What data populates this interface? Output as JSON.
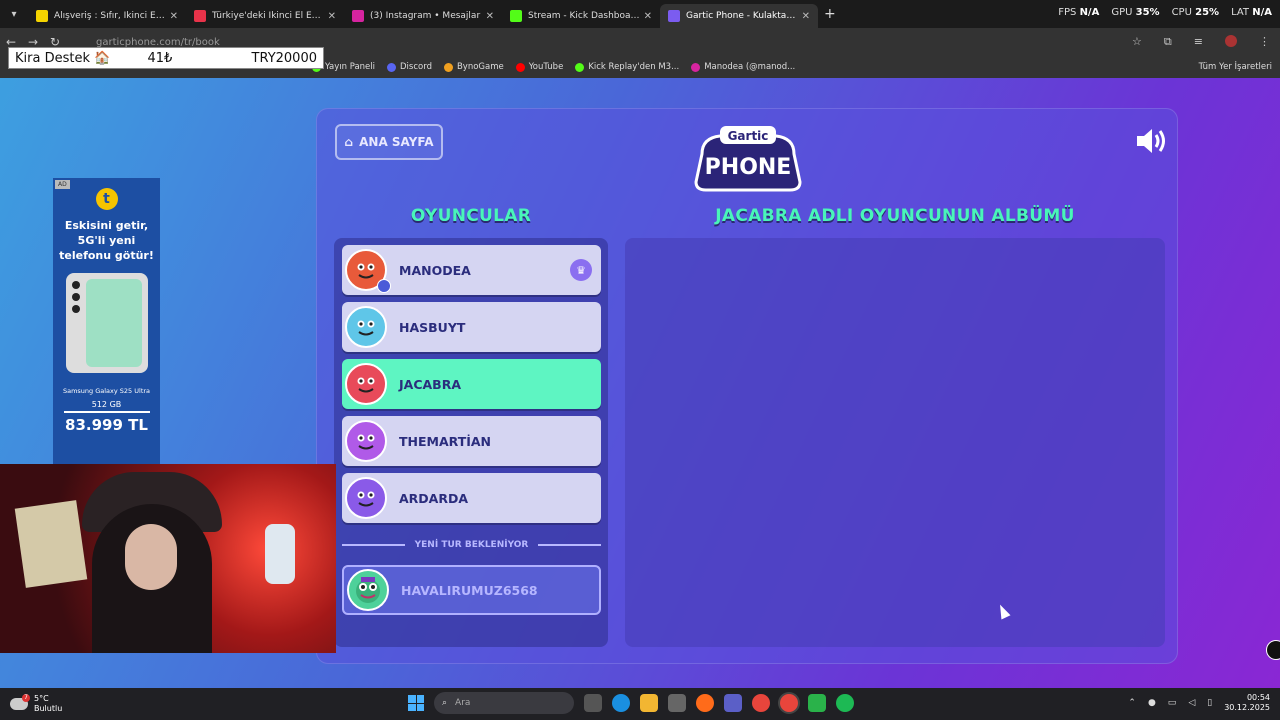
{
  "browser": {
    "tabs": [
      {
        "title": "Alışveriş : Sıfır, İkinci El Ürünler",
        "favicon_color": "#f5d400",
        "active": false
      },
      {
        "title": "Türkiye'deki İkinci El Eşyaları Al",
        "favicon_color": "#e8334a",
        "active": false
      },
      {
        "title": "(3) Instagram • Mesajlar",
        "favicon_color": "#d6249f",
        "active": false
      },
      {
        "title": "Stream - Kick Dashboard",
        "favicon_color": "#53fc18",
        "active": false
      },
      {
        "title": "Gartic Phone - Kulaktan Kulağa",
        "favicon_color": "#7b5cf0",
        "active": true
      }
    ],
    "new_tab": "+",
    "sysmon": {
      "fps_label": "FPS",
      "fps_value": "N/A",
      "gpu_label": "GPU",
      "gpu_value": "35",
      "cpu_label": "CPU",
      "cpu_value": "25",
      "lat_label": "LAT",
      "lat_value": "N/A"
    },
    "url": "garticphone.com/tr/book",
    "bookmarks": [
      {
        "label": "Yayın Paneli",
        "color": "#53fc18"
      },
      {
        "label": "Discord",
        "color": "#5865f2"
      },
      {
        "label": "BynoGame",
        "color": "#f0a020"
      },
      {
        "label": "YouTube",
        "color": "#ff0000"
      },
      {
        "label": "Kick Replay'den M3...",
        "color": "#53fc18"
      },
      {
        "label": "Manodea (@manod...",
        "color": "#d6249f"
      }
    ],
    "bookmarks_folder": "Tüm Yer İşaretleri"
  },
  "overlay": {
    "kira_label": "Kira Destek 🏠",
    "kira_amount": "41₺",
    "kira_goal": "TRY20000"
  },
  "ad": {
    "tag": "AD",
    "brand_letter": "t",
    "headline": "Eskisini getir, 5G'li yeni telefonu götür!",
    "model": "Samsung Galaxy S25 Ultra",
    "storage": "512 GB",
    "price": "83.999 TL"
  },
  "game": {
    "home_button": "ANA SAYFA",
    "logo_top": "Gartic",
    "logo_main": "PHONE",
    "players_title": "OYUNCULAR",
    "album_title": "JACABRA ADLI OYUNCUNUN ALBÜMÜ",
    "players": [
      {
        "name": "MANODEA",
        "selected": false,
        "host": true,
        "avatar_color": "#e85a3a"
      },
      {
        "name": "HASBUYT",
        "selected": false,
        "host": false,
        "avatar_color": "#5fc6e8"
      },
      {
        "name": "JACABRA",
        "selected": true,
        "host": false,
        "avatar_color": "#e84a5a"
      },
      {
        "name": "THEMARTİAN",
        "selected": false,
        "host": false,
        "avatar_color": "#b05ae8"
      },
      {
        "name": "ARDARDA",
        "selected": false,
        "host": false,
        "avatar_color": "#8a5ae8"
      }
    ],
    "waiting_label": "YENİ TUR BEKLENİYOR",
    "pending_player": {
      "name": "HAVALIRUMUZ6568",
      "avatar_color": "#4ed19a"
    }
  },
  "taskbar": {
    "temperature": "5°C",
    "weather_desc": "Bulutlu",
    "weather_badge": "7",
    "search_placeholder": "Ara",
    "time": "00:54",
    "date": "30.12.2025"
  }
}
